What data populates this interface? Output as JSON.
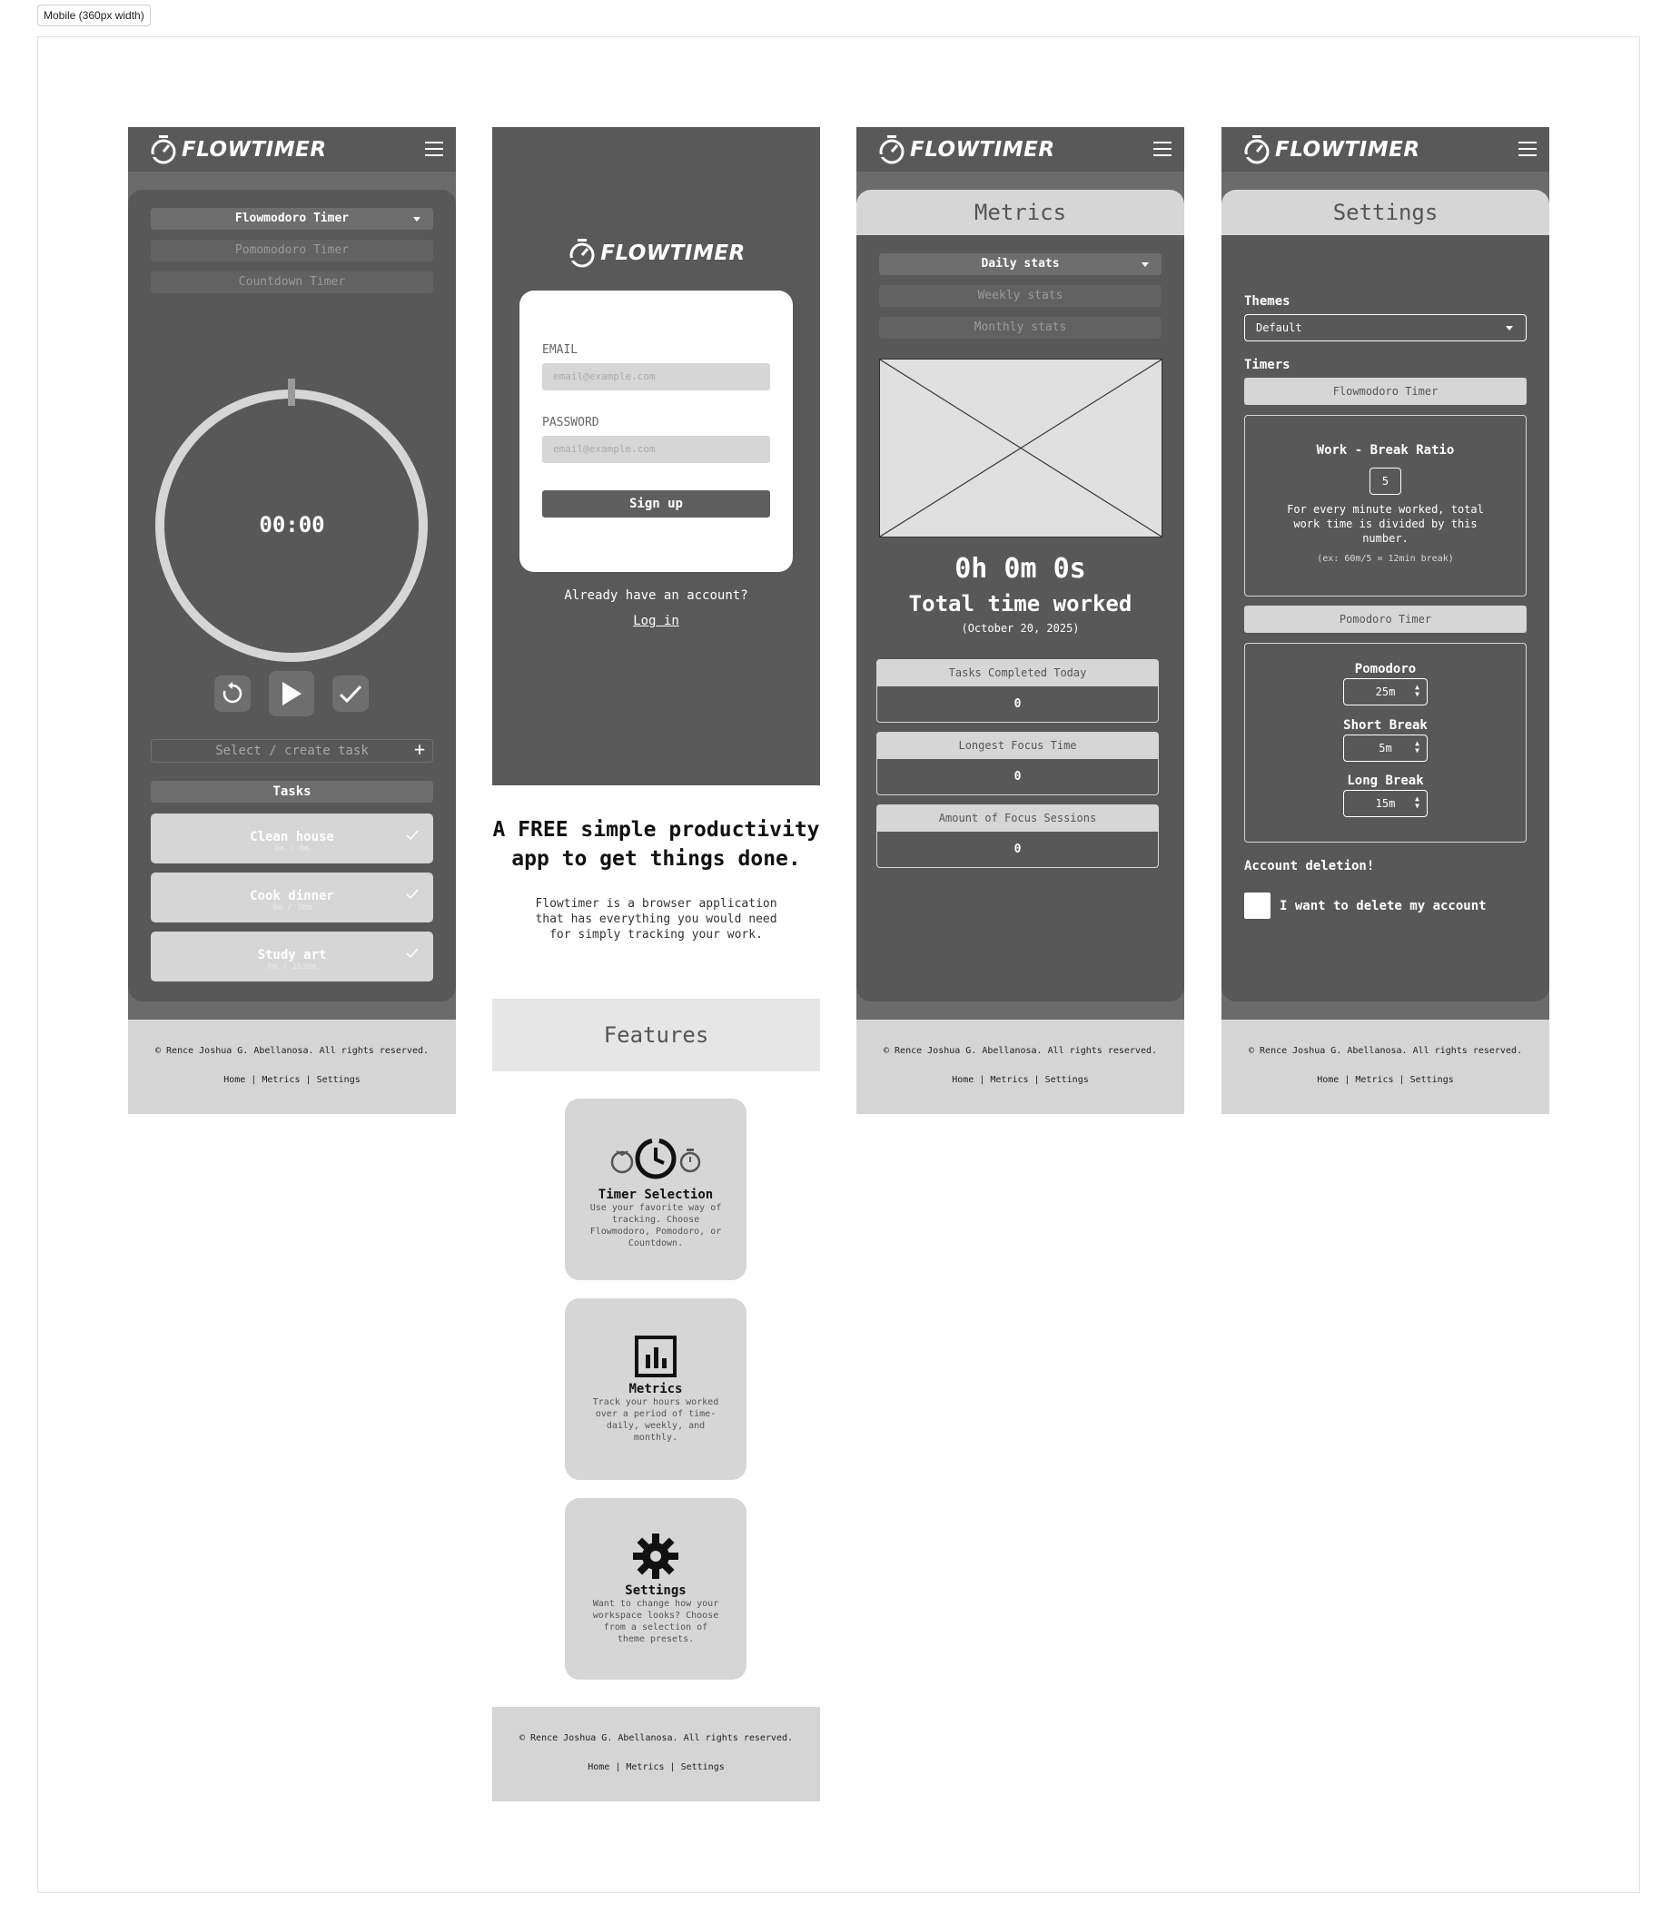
{
  "frame_label": "Mobile (360px width)",
  "brand": "FLOWTIMER",
  "footer": {
    "copyright": "© Rence Joshua G. Abellanosa. All rights reserved.",
    "links": "Home | Metrics | Settings"
  },
  "timer_screen": {
    "modes": [
      "Flowmodoro Timer",
      "Pomomodoro Timer",
      "Countdown Timer"
    ],
    "time": "00:00",
    "task_placeholder": "Select / create task",
    "tasks_heading": "Tasks",
    "tasks": [
      {
        "name": "Clean house",
        "progress": "0m / 0m"
      },
      {
        "name": "Cook dinner",
        "progress": "0m / 30m"
      },
      {
        "name": "Study art",
        "progress": "0m / 1h30m"
      }
    ]
  },
  "landing_screen": {
    "email_label": "EMAIL",
    "email_placeholder": "email@example.com",
    "password_label": "PASSWORD",
    "password_placeholder": "email@example.com",
    "signup_label": "Sign up",
    "have_account": "Already have an account?",
    "login_label": "Log in",
    "hero_title": "A FREE simple productivity app to get things done.",
    "hero_desc": "Flowtimer is a browser application that has everything you would need for simply tracking your work.",
    "features_title": "Features",
    "features": [
      {
        "title": "Timer Selection",
        "desc": "Use your favorite way of tracking. Choose Flowmodoro, Pomodoro, or Countdown."
      },
      {
        "title": "Metrics",
        "desc": "Track your hours worked over a period of time- daily, weekly, and monthly."
      },
      {
        "title": "Settings",
        "desc": "Want to change how your workspace looks? Choose from a selection of theme presets."
      }
    ]
  },
  "metrics_screen": {
    "title": "Metrics",
    "ranges": [
      "Daily stats",
      "Weekly stats",
      "Monthly stats"
    ],
    "total_time": "0h 0m 0s",
    "total_label": "Total time worked",
    "date": "(October 20, 2025)",
    "stats": [
      {
        "label": "Tasks Completed Today",
        "value": "0"
      },
      {
        "label": "Longest Focus Time",
        "value": "0"
      },
      {
        "label": "Amount of Focus Sessions",
        "value": "0"
      }
    ]
  },
  "settings_screen": {
    "title": "Settings",
    "themes_label": "Themes",
    "theme_value": "Default",
    "timers_label": "Timers",
    "flowmodoro_label": "Flowmodoro Timer",
    "ratio_title": "Work - Break Ratio",
    "ratio_value": "5",
    "ratio_desc": "For every minute worked, total work time is divided by this number.",
    "ratio_example": "(ex: 60m/5 = 12min break)",
    "pomodoro_label": "Pomodoro Timer",
    "pomodoro_title": "Pomodoro",
    "pomodoro_value": "25m",
    "short_break_title": "Short Break",
    "short_break_value": "5m",
    "long_break_title": "Long Break",
    "long_break_value": "15m",
    "deletion_label": "Account deletion!",
    "delete_checkbox_label": "I want to delete my account"
  }
}
